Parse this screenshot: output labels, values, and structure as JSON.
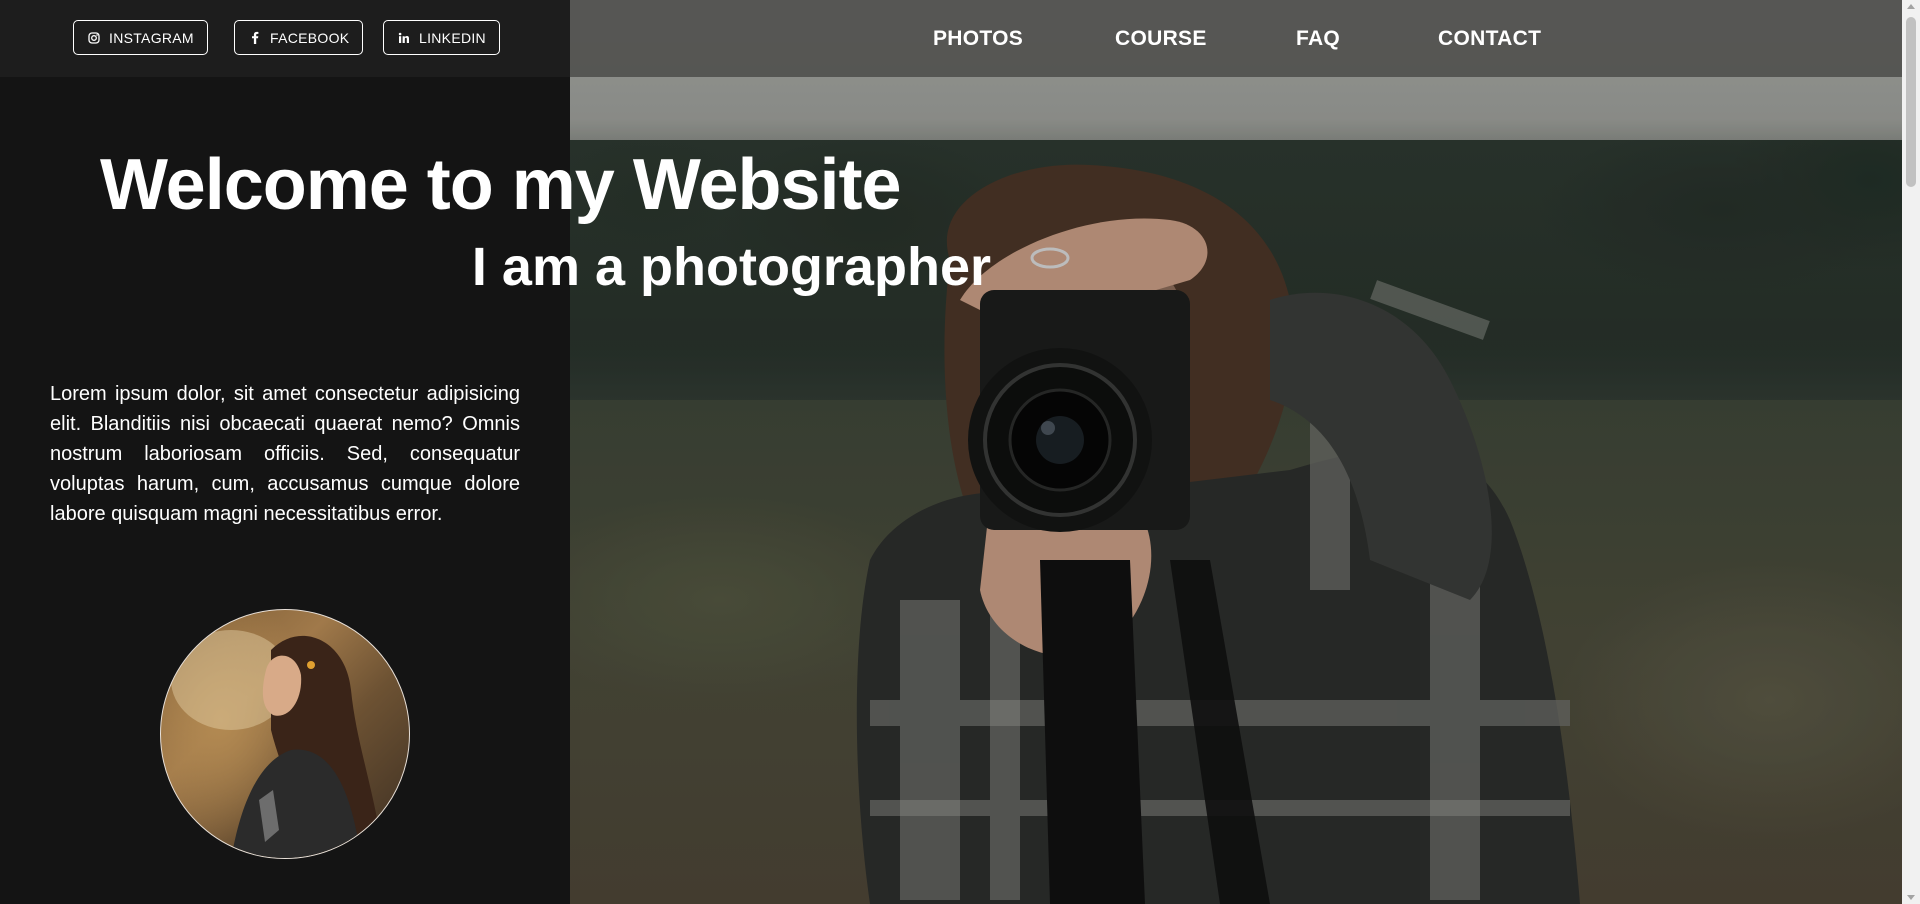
{
  "social": [
    {
      "label": "INSTAGRAM",
      "icon": "instagram-icon"
    },
    {
      "label": "FACEBOOK",
      "icon": "facebook-icon"
    },
    {
      "label": "LINKEDIN",
      "icon": "linkedin-icon"
    }
  ],
  "nav": {
    "items": [
      {
        "label": "PHOTOS"
      },
      {
        "label": "COURSE"
      },
      {
        "label": "FAQ"
      },
      {
        "label": "CONTACT"
      }
    ]
  },
  "hero": {
    "title": "Welcome to my Website",
    "subtitle": "I am a photographer",
    "about": "Lorem ipsum dolor, sit amet consectetur adipisicing elit. Blanditiis nisi obcaecati quaerat nemo? Omnis nostrum laboriosam officiis. Sed, consequatur voluptas harum, cum, accusamus cumque dolore labore quisquam magni necessitatibus error."
  },
  "colors": {
    "left_panel_bg": "#141414",
    "topbar_left_bg": "#1d1d1d",
    "topbar_right_bg": "#50504e",
    "text": "#ffffff"
  }
}
